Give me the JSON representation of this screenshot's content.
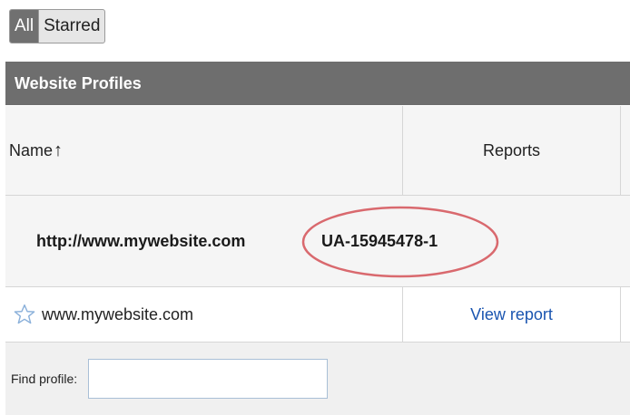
{
  "filters": {
    "all": "All",
    "starred": "Starred"
  },
  "panel": {
    "title": "Website Profiles"
  },
  "columns": {
    "name": "Name",
    "sort_indicator": "↑",
    "reports": "Reports"
  },
  "profile": {
    "url": "http://www.mywebsite.com",
    "tracking_id": "UA-15945478-1"
  },
  "site": {
    "name": "www.mywebsite.com",
    "report_link": "View report"
  },
  "find": {
    "label": "Find profile:",
    "value": ""
  },
  "colors": {
    "header_bg": "#6e6e6e",
    "highlight": "#d9696e",
    "link": "#1a55b0"
  },
  "icons": {
    "star": "star-outline-icon",
    "sort": "arrow-up-icon"
  }
}
